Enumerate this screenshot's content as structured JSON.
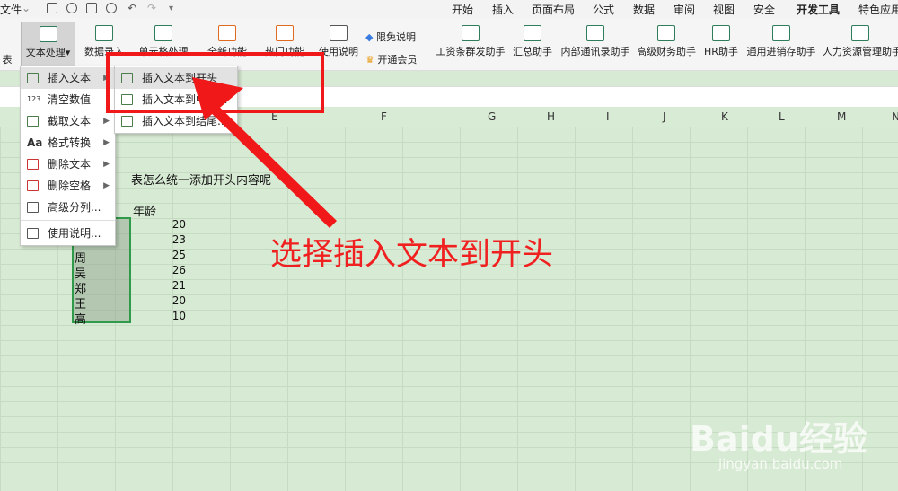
{
  "topbar": {
    "file": "文件",
    "tabs": [
      "开始",
      "插入",
      "页面布局",
      "公式",
      "数据",
      "审阅",
      "视图",
      "安全",
      "开发工具",
      "特色应用"
    ]
  },
  "ribbon": {
    "partial_left": "表",
    "text_processing": "文本处理",
    "data_entry": "数据录入",
    "cell_processing": "单元格处理",
    "new_features": "全新功能",
    "popular_features": "热门功能",
    "instructions": "使用说明",
    "free_label": "限免说明",
    "membership": "开通会员",
    "helpers": [
      "工资条群发助手",
      "汇总助手",
      "内部通讯录助手",
      "高级财务助手",
      "HR助手",
      "通用进销存助手",
      "人力资源管理助手"
    ]
  },
  "columns": [
    "E",
    "F",
    "G",
    "H",
    "I",
    "J",
    "K",
    "L",
    "M"
  ],
  "main_menu": {
    "items": [
      {
        "label": "插入文本",
        "icon": "insert-text-icon",
        "arrow": true,
        "highlight": true
      },
      {
        "label": "清空数值",
        "icon": "clear-values-icon",
        "arrow": false
      },
      {
        "label": "截取文本",
        "icon": "extract-text-icon",
        "arrow": true
      },
      {
        "label": "格式转换",
        "icon": "format-convert-icon",
        "arrow": true
      },
      {
        "label": "删除文本",
        "icon": "delete-text-icon",
        "arrow": true
      },
      {
        "label": "删除空格",
        "icon": "delete-spaces-icon",
        "arrow": true
      },
      {
        "label": "高级分列...",
        "icon": "advanced-split-icon",
        "arrow": false
      },
      {
        "label": "使用说明...",
        "icon": "instructions-icon",
        "arrow": false
      }
    ]
  },
  "sub_menu": {
    "items": [
      "插入文本到开头",
      "插入文本到中间...",
      "插入文本到结尾..."
    ]
  },
  "sheet": {
    "question": "表怎么统一添加开头内容呢",
    "age_header": "年龄",
    "names": [
      "周",
      "吴",
      "郑",
      "王",
      "高"
    ],
    "ages": [
      "20",
      "23",
      "25",
      "26",
      "21",
      "20",
      "10"
    ]
  },
  "annotation": {
    "text": "选择插入文本到开头",
    "color": "#f02020"
  },
  "watermark": {
    "brand": "Baidu经验",
    "url": "jingyan.baidu.com"
  }
}
